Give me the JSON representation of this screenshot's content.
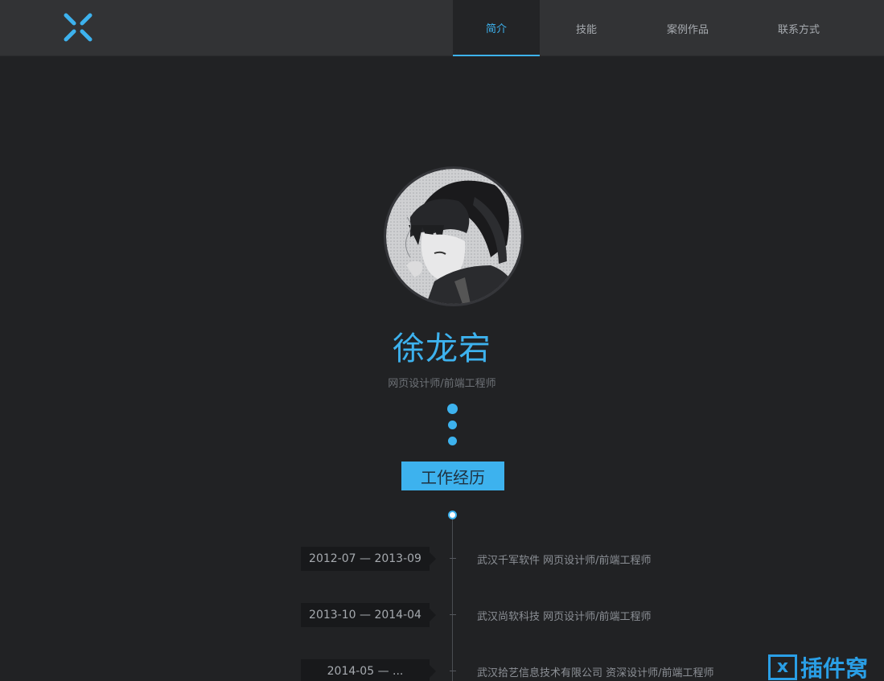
{
  "header": {
    "logo_icon": "x-cross-logo-icon",
    "nav": [
      {
        "label": "简介",
        "active": true
      },
      {
        "label": "技能",
        "active": false
      },
      {
        "label": "案例作品",
        "active": false
      },
      {
        "label": "联系方式",
        "active": false
      }
    ]
  },
  "profile": {
    "name": "徐龙宕",
    "title": "网页设计师/前端工程师"
  },
  "section": {
    "label": "工作经历"
  },
  "timeline": [
    {
      "date": "2012-07 — 2013-09",
      "desc": "武汉千军软件 网页设计师/前端工程师"
    },
    {
      "date": "2013-10 — 2014-04",
      "desc": "武汉尚软科技 网页设计师/前端工程师"
    },
    {
      "date": "2014-05 — ...",
      "desc": "武汉拾艺信息技术有限公司 资深设计师/前端工程师"
    }
  ],
  "watermark": {
    "icon_glyph": "x",
    "text": "插件窝"
  },
  "colors": {
    "accent": "#3db2ee",
    "background": "#212224",
    "header": "#323335"
  }
}
